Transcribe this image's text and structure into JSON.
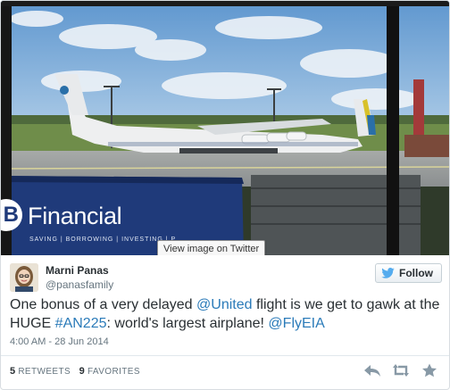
{
  "media": {
    "billboard_text": "Financial",
    "billboard_logo": "B",
    "billboard_tagline": "SAVING | BORROWING | INVESTING | P",
    "tooltip": "View image on Twitter"
  },
  "user": {
    "name": "Marni Panas",
    "handle": "@panasfamily"
  },
  "follow": {
    "label": "Follow",
    "icon": "twitter-bird-icon"
  },
  "tweet": {
    "text_1": "One bonus of a very delayed ",
    "mention_1": "@United",
    "text_2": " flight is we get to gawk at the HUGE ",
    "hashtag": "#AN225",
    "text_3": ": world's largest airplane! ",
    "mention_2": "@FlyEIA"
  },
  "timestamp": "4:00 AM - 28 Jun 2014",
  "stats": {
    "retweets_count": "5",
    "retweets_label": "RETWEETS",
    "favorites_count": "9",
    "favorites_label": "FAVORITES"
  },
  "actions": [
    "reply-icon",
    "retweet-icon",
    "favorite-icon"
  ],
  "colors": {
    "link": "#2b7bb9",
    "text": "#292f33",
    "muted": "#66757f"
  }
}
